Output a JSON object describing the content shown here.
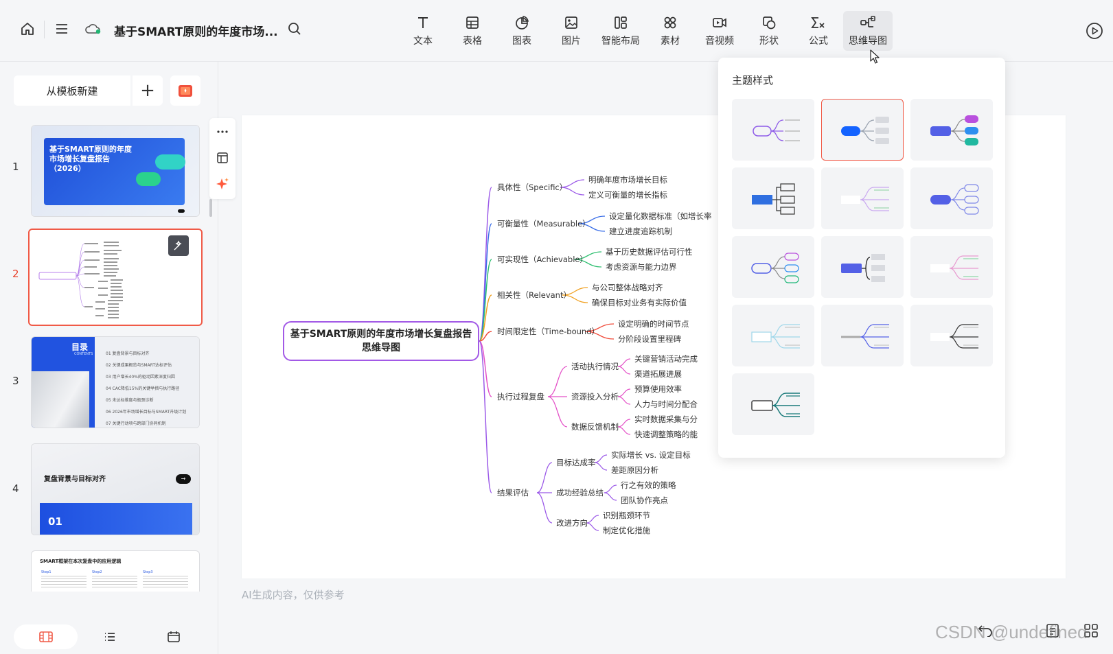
{
  "header": {
    "doc_title": "基于SMART原则的年度市场...",
    "tools": [
      {
        "label": "文本",
        "icon": "text-icon"
      },
      {
        "label": "表格",
        "icon": "table-icon"
      },
      {
        "label": "图表",
        "icon": "chart-icon"
      },
      {
        "label": "图片",
        "icon": "image-icon"
      },
      {
        "label": "智能布局",
        "icon": "smart-layout-icon"
      },
      {
        "label": "素材",
        "icon": "material-icon"
      },
      {
        "label": "音视频",
        "icon": "video-icon"
      },
      {
        "label": "形状",
        "icon": "shape-icon"
      },
      {
        "label": "公式",
        "icon": "formula-icon"
      },
      {
        "label": "思维导图",
        "icon": "mindmap-icon"
      }
    ],
    "active_tool": "思维导图"
  },
  "left_panel": {
    "new_from_template": "从模板新建",
    "plus_label": "+",
    "slides": [
      {
        "num": "1",
        "title": "基于SMART原则的年度市场增长复盘报告（2026）"
      },
      {
        "num": "2",
        "title": ""
      },
      {
        "num": "3",
        "title": "目录"
      },
      {
        "num": "4",
        "title": "复盘背景与目标对齐",
        "tag": "01"
      },
      {
        "num": "5",
        "title": "SMART框架在本次复盘中的应用逻辑"
      }
    ],
    "selected_slide": "2",
    "toc_items": [
      "01 复盘背景与目标对齐",
      "02 关键成果概览与SMART达标评估",
      "03 用户增长40%的驱动因素深度归因",
      "04 CAC降低15%的关键举措与执行路径",
      "05 未达标维度与瓶颈诊断",
      "06 2026年市场增长目标与SMART升级计划",
      "07 关键行动项与跨部门协同机制"
    ],
    "toc_sub": "CONTENTS",
    "thumb5_steps": [
      "Step1",
      "Step2",
      "Step3"
    ]
  },
  "canvas": {
    "ai_note": "AI生成内容，仅供参考",
    "mindmap": {
      "root_line1": "基于SMART原则的年度市场增长复盘报告",
      "root_line2": "思维导图",
      "branches": [
        {
          "label": "具体性（Specific）",
          "color": "#9b59e8",
          "children": [
            "明确年度市场增长目标",
            "定义可衡量的增长指标"
          ]
        },
        {
          "label": "可衡量性（Measurable）",
          "color": "#3b6fe8",
          "children": [
            "设定量化数据标准（如增长率",
            "建立进度追踪机制"
          ]
        },
        {
          "label": "可实现性（Achievable）",
          "color": "#2fbf71",
          "children": [
            "基于历史数据评估可行性",
            "考虑资源与能力边界"
          ]
        },
        {
          "label": "相关性（Relevant）",
          "color": "#f0a020",
          "children": [
            "与公司整体战略对齐",
            "确保目标对业务有实际价值"
          ]
        },
        {
          "label": "时间限定性（Time-bound）",
          "color": "#f04b3a",
          "children": [
            "设定明确的时间节点",
            "分阶段设置里程碑"
          ]
        },
        {
          "label": "执行过程复盘",
          "color": "#e452c8",
          "children": [
            {
              "label": "活动执行情况",
              "children": [
                "关键营销活动完成",
                "渠道拓展进展"
              ]
            },
            {
              "label": "资源投入分析",
              "children": [
                "预算使用效率",
                "人力与时间分配合"
              ]
            },
            {
              "label": "数据反馈机制",
              "children": [
                "实时数据采集与分",
                "快速调整策略的能"
              ]
            }
          ]
        },
        {
          "label": "结果评估",
          "color": "#9b59e8",
          "children": [
            {
              "label": "目标达成率",
              "children": [
                "实际增长 vs. 设定目标",
                "差距原因分析"
              ]
            },
            {
              "label": "成功经验总结",
              "children": [
                "行之有效的策略",
                "团队协作亮点"
              ]
            },
            {
              "label": "改进方向",
              "children": [
                "识别瓶颈环节",
                "制定优化措施"
              ]
            }
          ]
        }
      ]
    }
  },
  "popup": {
    "title": "主题样式",
    "selected_index": 1,
    "styles": [
      {
        "name": "outline-purple"
      },
      {
        "name": "solid-blue-gray"
      },
      {
        "name": "solid-indigo-color"
      },
      {
        "name": "box-blue"
      },
      {
        "name": "light-multicolor"
      },
      {
        "name": "indigo-outline-children"
      },
      {
        "name": "outline-multi"
      },
      {
        "name": "indigo-bracket"
      },
      {
        "name": "light-pink-green"
      },
      {
        "name": "light-cyan"
      },
      {
        "name": "gray-indigo"
      },
      {
        "name": "white-black"
      },
      {
        "name": "outline-teal"
      }
    ]
  },
  "watermark": "CSDN @undefined",
  "colors": {
    "accent": "#f05a47",
    "primary_blue": "#2563eb"
  }
}
